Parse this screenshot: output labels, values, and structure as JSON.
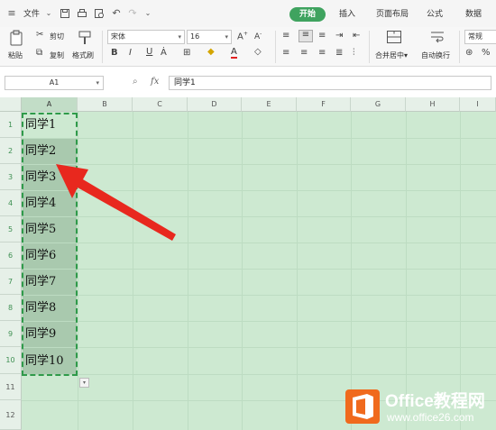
{
  "menubar": {
    "file_label": "文件",
    "tabs": [
      "开始",
      "插入",
      "页面布局",
      "公式",
      "数据"
    ]
  },
  "ribbon": {
    "paste": "粘贴",
    "cut": "剪切",
    "copy": "复制",
    "format_painter": "格式刷",
    "font_name": "宋体",
    "font_size": "16",
    "merge_center": "合并居中",
    "wrap_text": "自动换行",
    "number_format": "常规"
  },
  "formula_bar": {
    "name_box": "A1",
    "fx_label": "fx",
    "content": "同学1"
  },
  "grid": {
    "columns": [
      "A",
      "B",
      "C",
      "D",
      "E",
      "F",
      "G",
      "H",
      "I"
    ],
    "rows": [
      "1",
      "2",
      "3",
      "4",
      "5",
      "6",
      "7",
      "8",
      "9",
      "10",
      "11",
      "12"
    ],
    "column_a": [
      "同学1",
      "同学2",
      "同学3",
      "同学4",
      "同学5",
      "同学6",
      "同学7",
      "同学8",
      "同学9",
      "同学10"
    ]
  },
  "watermark": {
    "title": "Office教程网",
    "url": "www.office26.com"
  },
  "colors": {
    "accent_green": "#3fa35f",
    "sheet_background": "#cde9d1",
    "selection_shade": "#a9c9ae",
    "arrow_red": "#e8281e",
    "watermark_orange": "#f06a1d"
  }
}
